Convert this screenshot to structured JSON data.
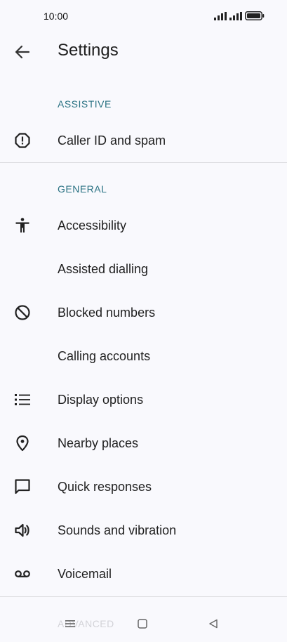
{
  "status": {
    "time": "10:00"
  },
  "header": {
    "title": "Settings"
  },
  "sections": {
    "assistive": "ASSISTIVE",
    "general": "GENERAL",
    "advanced": "ADVANCED"
  },
  "items": [
    {
      "label": "Caller ID and spam",
      "icon": "alert-octagon-icon"
    },
    {
      "label": "Accessibility",
      "icon": "accessibility-icon"
    },
    {
      "label": "Assisted dialling",
      "icon": ""
    },
    {
      "label": "Blocked numbers",
      "icon": "block-icon"
    },
    {
      "label": "Calling accounts",
      "icon": ""
    },
    {
      "label": "Display options",
      "icon": "list-icon"
    },
    {
      "label": "Nearby places",
      "icon": "location-pin-icon"
    },
    {
      "label": "Quick responses",
      "icon": "chat-bubble-icon"
    },
    {
      "label": "Sounds and vibration",
      "icon": "speaker-icon"
    },
    {
      "label": "Voicemail",
      "icon": "voicemail-icon"
    }
  ],
  "colors": {
    "section": "#2a7283",
    "background": "#f9f9fd",
    "text": "#1f1f1f"
  }
}
